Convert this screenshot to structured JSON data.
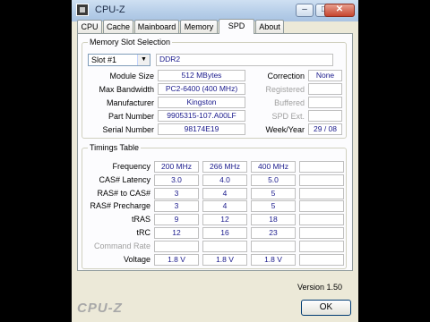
{
  "window": {
    "title": "CPU-Z",
    "controls": {
      "minimize": "–",
      "maximize": "□",
      "close": "✕"
    }
  },
  "tabs": [
    "CPU",
    "Cache",
    "Mainboard",
    "Memory",
    "SPD",
    "About"
  ],
  "active_tab": "SPD",
  "slot_selection": {
    "legend": "Memory Slot Selection",
    "slot_value": "Slot #1",
    "type": "DDR2",
    "fields": {
      "module_size": {
        "label": "Module Size",
        "value": "512 MBytes"
      },
      "max_bandwidth": {
        "label": "Max Bandwidth",
        "value": "PC2-6400 (400 MHz)"
      },
      "manufacturer": {
        "label": "Manufacturer",
        "value": "Kingston"
      },
      "part_number": {
        "label": "Part Number",
        "value": "9905315-107.A00LF"
      },
      "serial_number": {
        "label": "Serial Number",
        "value": "98174E19"
      }
    },
    "right_fields": {
      "correction": {
        "label": "Correction",
        "value": "None"
      },
      "registered": {
        "label": "Registered",
        "value": ""
      },
      "buffered": {
        "label": "Buffered",
        "value": ""
      },
      "spd_ext": {
        "label": "SPD Ext.",
        "value": ""
      },
      "week_year": {
        "label": "Week/Year",
        "value": "29 / 08"
      }
    }
  },
  "timings": {
    "legend": "Timings Table",
    "rows": [
      {
        "label": "Frequency",
        "values": [
          "200 MHz",
          "266 MHz",
          "400 MHz",
          ""
        ]
      },
      {
        "label": "CAS# Latency",
        "values": [
          "3.0",
          "4.0",
          "5.0",
          ""
        ]
      },
      {
        "label": "RAS# to CAS#",
        "values": [
          "3",
          "4",
          "5",
          ""
        ]
      },
      {
        "label": "RAS# Precharge",
        "values": [
          "3",
          "4",
          "5",
          ""
        ]
      },
      {
        "label": "tRAS",
        "values": [
          "9",
          "12",
          "18",
          ""
        ]
      },
      {
        "label": "tRC",
        "values": [
          "12",
          "16",
          "23",
          ""
        ]
      },
      {
        "label": "Command Rate",
        "values": [
          "",
          "",
          "",
          ""
        ]
      },
      {
        "label": "Voltage",
        "values": [
          "1.8 V",
          "1.8 V",
          "1.8 V",
          ""
        ]
      }
    ]
  },
  "footer": {
    "version": "Version 1.50",
    "brand": "CPU-Z",
    "ok_label": "OK"
  }
}
